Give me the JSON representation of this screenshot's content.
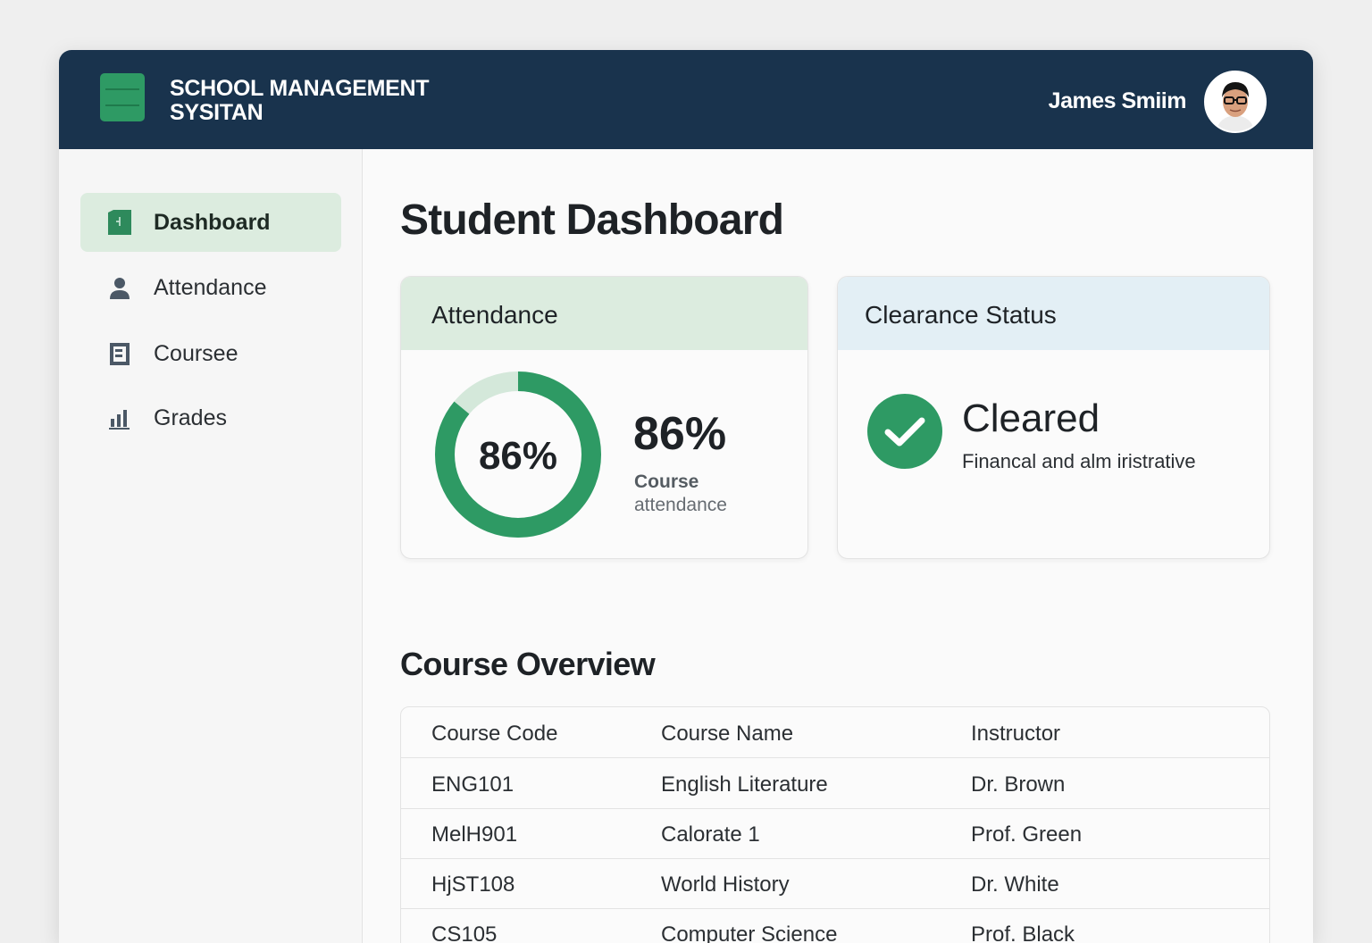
{
  "header": {
    "app_title_line1": "SCHOOL MANAGEMENT",
    "app_title_line2": "SYSITAN",
    "user_name": "James Smiim"
  },
  "sidebar": {
    "items": [
      {
        "label": "Dashboard",
        "icon": "dashboard-icon",
        "active": true
      },
      {
        "label": "Attendance",
        "icon": "user-icon",
        "active": false
      },
      {
        "label": "Coursee",
        "icon": "book-icon",
        "active": false
      },
      {
        "label": "Grades",
        "icon": "bar-chart-icon",
        "active": false
      }
    ]
  },
  "main": {
    "page_title": "Student Dashboard",
    "attendance_card": {
      "title": "Attendance",
      "ring_value": "86%",
      "percent_text": "86%",
      "fraction": 0.86,
      "sub_label_1": "Course",
      "sub_label_2": "attendance"
    },
    "clearance_card": {
      "title": "Clearance Status",
      "status": "Cleared",
      "detail": "Financal and alm iristrative"
    },
    "course_overview": {
      "title": "Course Overview",
      "columns": [
        "Course Code",
        "Course Name",
        "Instructor"
      ],
      "rows": [
        [
          "ENG101",
          "English Literature",
          "Dr. Brown"
        ],
        [
          "MelH901",
          "Calorate 1",
          "Prof. Green"
        ],
        [
          "HjST108",
          "World History",
          "Dr. White"
        ],
        [
          "CS105",
          "Computer Science",
          "Prof. Black"
        ]
      ]
    }
  },
  "colors": {
    "header_bg": "#19334d",
    "accent_green": "#2e9a64",
    "attendance_head_bg": "#dcecdf",
    "clearance_head_bg": "#e3eff5"
  }
}
